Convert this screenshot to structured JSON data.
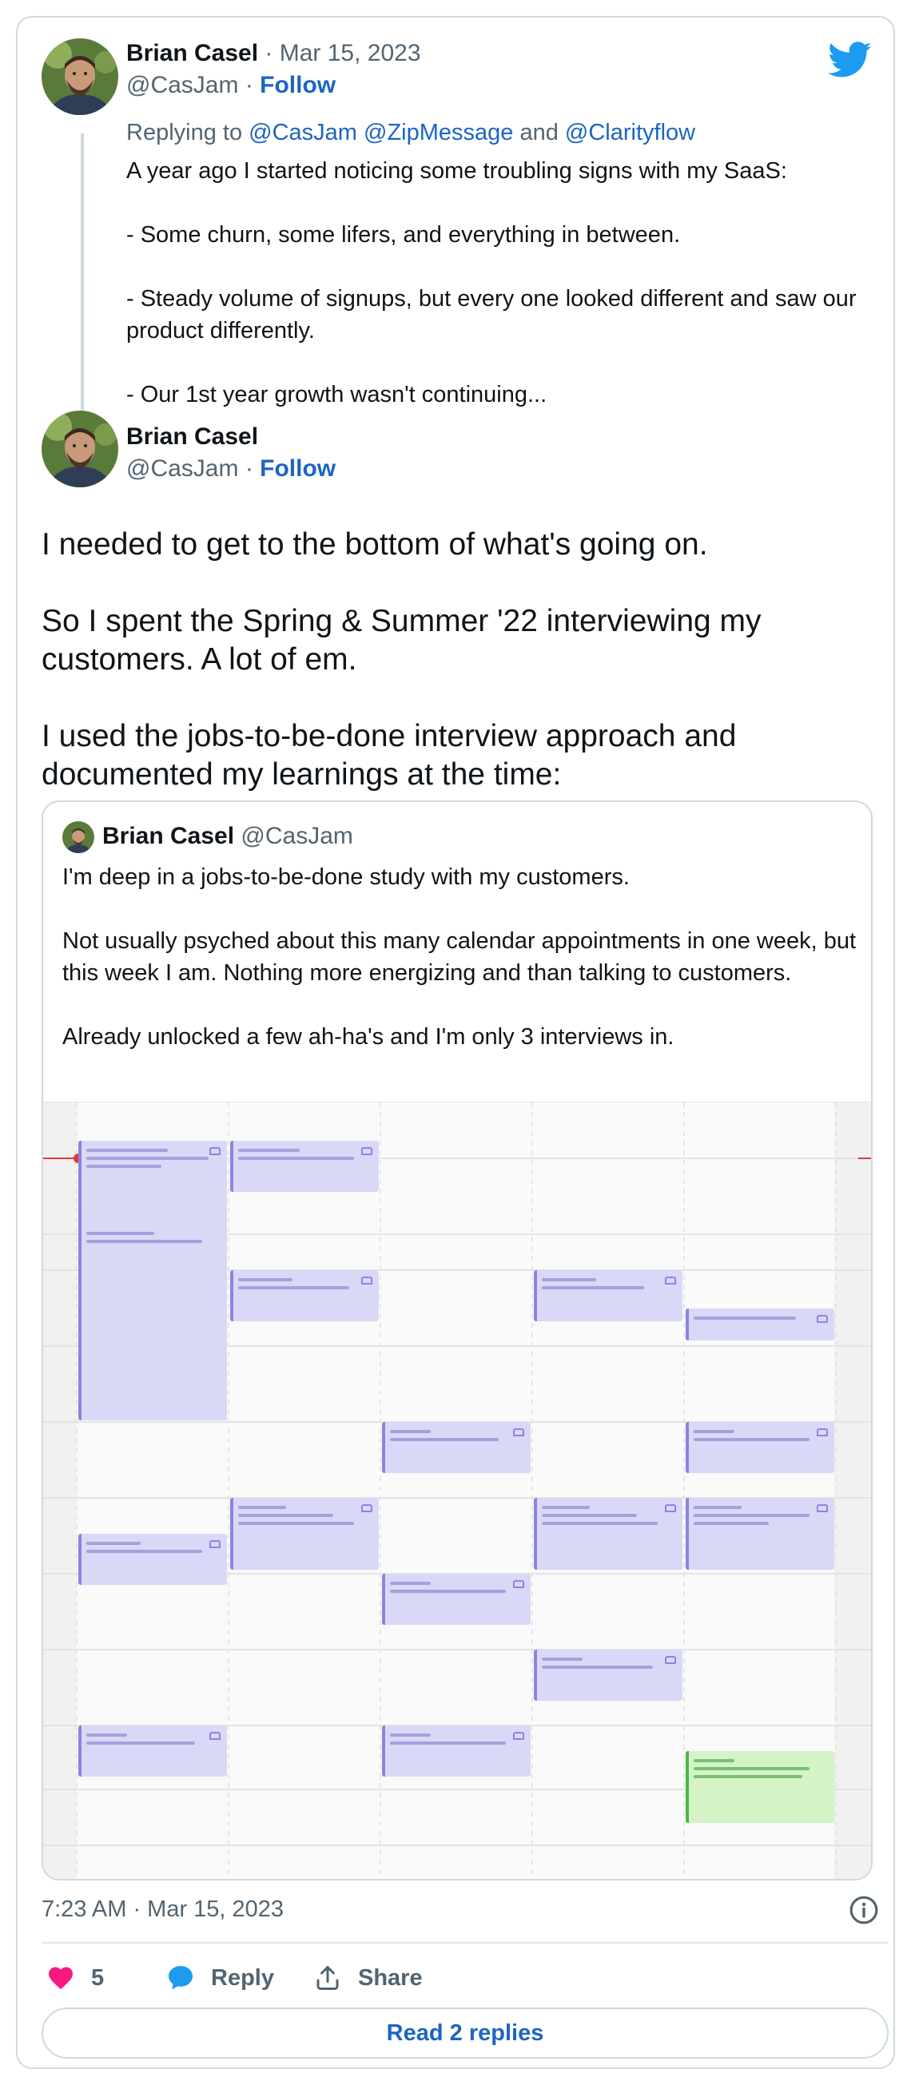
{
  "tweet1": {
    "author": "Brian Casel",
    "date": "· Mar 15, 2023",
    "handle": "@CasJam",
    "sep": " · ",
    "follow": "Follow",
    "replying_prefix": "Replying to ",
    "replying_to": "@CasJam @ZipMessage",
    "replying_and": " and ",
    "replying_last": "@Clarityflow",
    "lines": [
      "A year ago I started noticing some troubling signs with my SaaS:",
      "- Some churn, some lifers, and everything in between.",
      "- Steady volume of signups, but every one looked different and saw our product differently.",
      "- Our 1st year growth wasn't continuing..."
    ]
  },
  "tweet2": {
    "author": "Brian Casel",
    "handle": "@CasJam",
    "sep": " · ",
    "follow": "Follow",
    "paragraphs": [
      "I needed to get to the bottom of what's going on.",
      "So I spent the Spring & Summer '22 interviewing my customers.  A lot of em.",
      "I used the jobs-to-be-done interview approach and documented my learnings at the time:"
    ]
  },
  "quoted": {
    "author": "Brian Casel",
    "handle": "@CasJam",
    "paragraphs": [
      "I'm deep in a jobs-to-be-done study with my customers.",
      "Not usually psyched about this many calendar appointments in one week, but this week I am.  Nothing more energizing and than talking to customers.",
      "Already unlocked a few ah-ha's and I'm only 3 interviews in."
    ]
  },
  "footer": {
    "timestamp": "7:23 AM · Mar 15, 2023",
    "likes": "5",
    "reply": "Reply",
    "share": "Share",
    "read_replies": "Read 2 replies"
  },
  "colors": {
    "accent": "#1d65c1",
    "like": "#f91880",
    "bird": "#1d9bf0",
    "event": "#dad8f7",
    "event_green": "#d4f3c7"
  },
  "icons": [
    "twitter-bird-icon",
    "heart-icon",
    "reply-bubble-icon",
    "share-icon",
    "info-icon"
  ]
}
